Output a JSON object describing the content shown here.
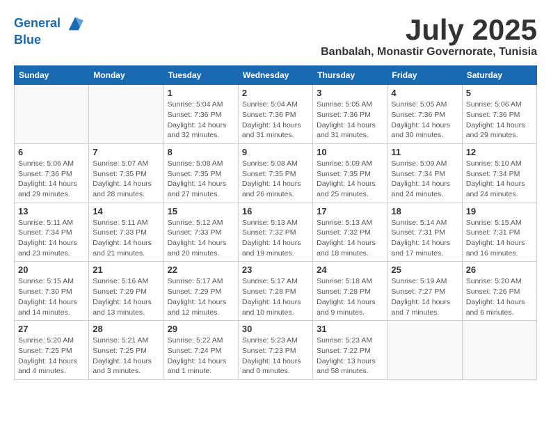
{
  "logo": {
    "line1": "General",
    "line2": "Blue"
  },
  "title": "July 2025",
  "subtitle": "Banbalah, Monastir Governorate, Tunisia",
  "weekdays": [
    "Sunday",
    "Monday",
    "Tuesday",
    "Wednesday",
    "Thursday",
    "Friday",
    "Saturday"
  ],
  "weeks": [
    [
      {
        "day": "",
        "info": ""
      },
      {
        "day": "",
        "info": ""
      },
      {
        "day": "1",
        "info": "Sunrise: 5:04 AM\nSunset: 7:36 PM\nDaylight: 14 hours\nand 32 minutes."
      },
      {
        "day": "2",
        "info": "Sunrise: 5:04 AM\nSunset: 7:36 PM\nDaylight: 14 hours\nand 31 minutes."
      },
      {
        "day": "3",
        "info": "Sunrise: 5:05 AM\nSunset: 7:36 PM\nDaylight: 14 hours\nand 31 minutes."
      },
      {
        "day": "4",
        "info": "Sunrise: 5:05 AM\nSunset: 7:36 PM\nDaylight: 14 hours\nand 30 minutes."
      },
      {
        "day": "5",
        "info": "Sunrise: 5:06 AM\nSunset: 7:36 PM\nDaylight: 14 hours\nand 29 minutes."
      }
    ],
    [
      {
        "day": "6",
        "info": "Sunrise: 5:06 AM\nSunset: 7:36 PM\nDaylight: 14 hours\nand 29 minutes."
      },
      {
        "day": "7",
        "info": "Sunrise: 5:07 AM\nSunset: 7:35 PM\nDaylight: 14 hours\nand 28 minutes."
      },
      {
        "day": "8",
        "info": "Sunrise: 5:08 AM\nSunset: 7:35 PM\nDaylight: 14 hours\nand 27 minutes."
      },
      {
        "day": "9",
        "info": "Sunrise: 5:08 AM\nSunset: 7:35 PM\nDaylight: 14 hours\nand 26 minutes."
      },
      {
        "day": "10",
        "info": "Sunrise: 5:09 AM\nSunset: 7:35 PM\nDaylight: 14 hours\nand 25 minutes."
      },
      {
        "day": "11",
        "info": "Sunrise: 5:09 AM\nSunset: 7:34 PM\nDaylight: 14 hours\nand 24 minutes."
      },
      {
        "day": "12",
        "info": "Sunrise: 5:10 AM\nSunset: 7:34 PM\nDaylight: 14 hours\nand 24 minutes."
      }
    ],
    [
      {
        "day": "13",
        "info": "Sunrise: 5:11 AM\nSunset: 7:34 PM\nDaylight: 14 hours\nand 23 minutes."
      },
      {
        "day": "14",
        "info": "Sunrise: 5:11 AM\nSunset: 7:33 PM\nDaylight: 14 hours\nand 21 minutes."
      },
      {
        "day": "15",
        "info": "Sunrise: 5:12 AM\nSunset: 7:33 PM\nDaylight: 14 hours\nand 20 minutes."
      },
      {
        "day": "16",
        "info": "Sunrise: 5:13 AM\nSunset: 7:32 PM\nDaylight: 14 hours\nand 19 minutes."
      },
      {
        "day": "17",
        "info": "Sunrise: 5:13 AM\nSunset: 7:32 PM\nDaylight: 14 hours\nand 18 minutes."
      },
      {
        "day": "18",
        "info": "Sunrise: 5:14 AM\nSunset: 7:31 PM\nDaylight: 14 hours\nand 17 minutes."
      },
      {
        "day": "19",
        "info": "Sunrise: 5:15 AM\nSunset: 7:31 PM\nDaylight: 14 hours\nand 16 minutes."
      }
    ],
    [
      {
        "day": "20",
        "info": "Sunrise: 5:15 AM\nSunset: 7:30 PM\nDaylight: 14 hours\nand 14 minutes."
      },
      {
        "day": "21",
        "info": "Sunrise: 5:16 AM\nSunset: 7:29 PM\nDaylight: 14 hours\nand 13 minutes."
      },
      {
        "day": "22",
        "info": "Sunrise: 5:17 AM\nSunset: 7:29 PM\nDaylight: 14 hours\nand 12 minutes."
      },
      {
        "day": "23",
        "info": "Sunrise: 5:17 AM\nSunset: 7:28 PM\nDaylight: 14 hours\nand 10 minutes."
      },
      {
        "day": "24",
        "info": "Sunrise: 5:18 AM\nSunset: 7:28 PM\nDaylight: 14 hours\nand 9 minutes."
      },
      {
        "day": "25",
        "info": "Sunrise: 5:19 AM\nSunset: 7:27 PM\nDaylight: 14 hours\nand 7 minutes."
      },
      {
        "day": "26",
        "info": "Sunrise: 5:20 AM\nSunset: 7:26 PM\nDaylight: 14 hours\nand 6 minutes."
      }
    ],
    [
      {
        "day": "27",
        "info": "Sunrise: 5:20 AM\nSunset: 7:25 PM\nDaylight: 14 hours\nand 4 minutes."
      },
      {
        "day": "28",
        "info": "Sunrise: 5:21 AM\nSunset: 7:25 PM\nDaylight: 14 hours\nand 3 minutes."
      },
      {
        "day": "29",
        "info": "Sunrise: 5:22 AM\nSunset: 7:24 PM\nDaylight: 14 hours\nand 1 minute."
      },
      {
        "day": "30",
        "info": "Sunrise: 5:23 AM\nSunset: 7:23 PM\nDaylight: 14 hours\nand 0 minutes."
      },
      {
        "day": "31",
        "info": "Sunrise: 5:23 AM\nSunset: 7:22 PM\nDaylight: 13 hours\nand 58 minutes."
      },
      {
        "day": "",
        "info": ""
      },
      {
        "day": "",
        "info": ""
      }
    ]
  ]
}
